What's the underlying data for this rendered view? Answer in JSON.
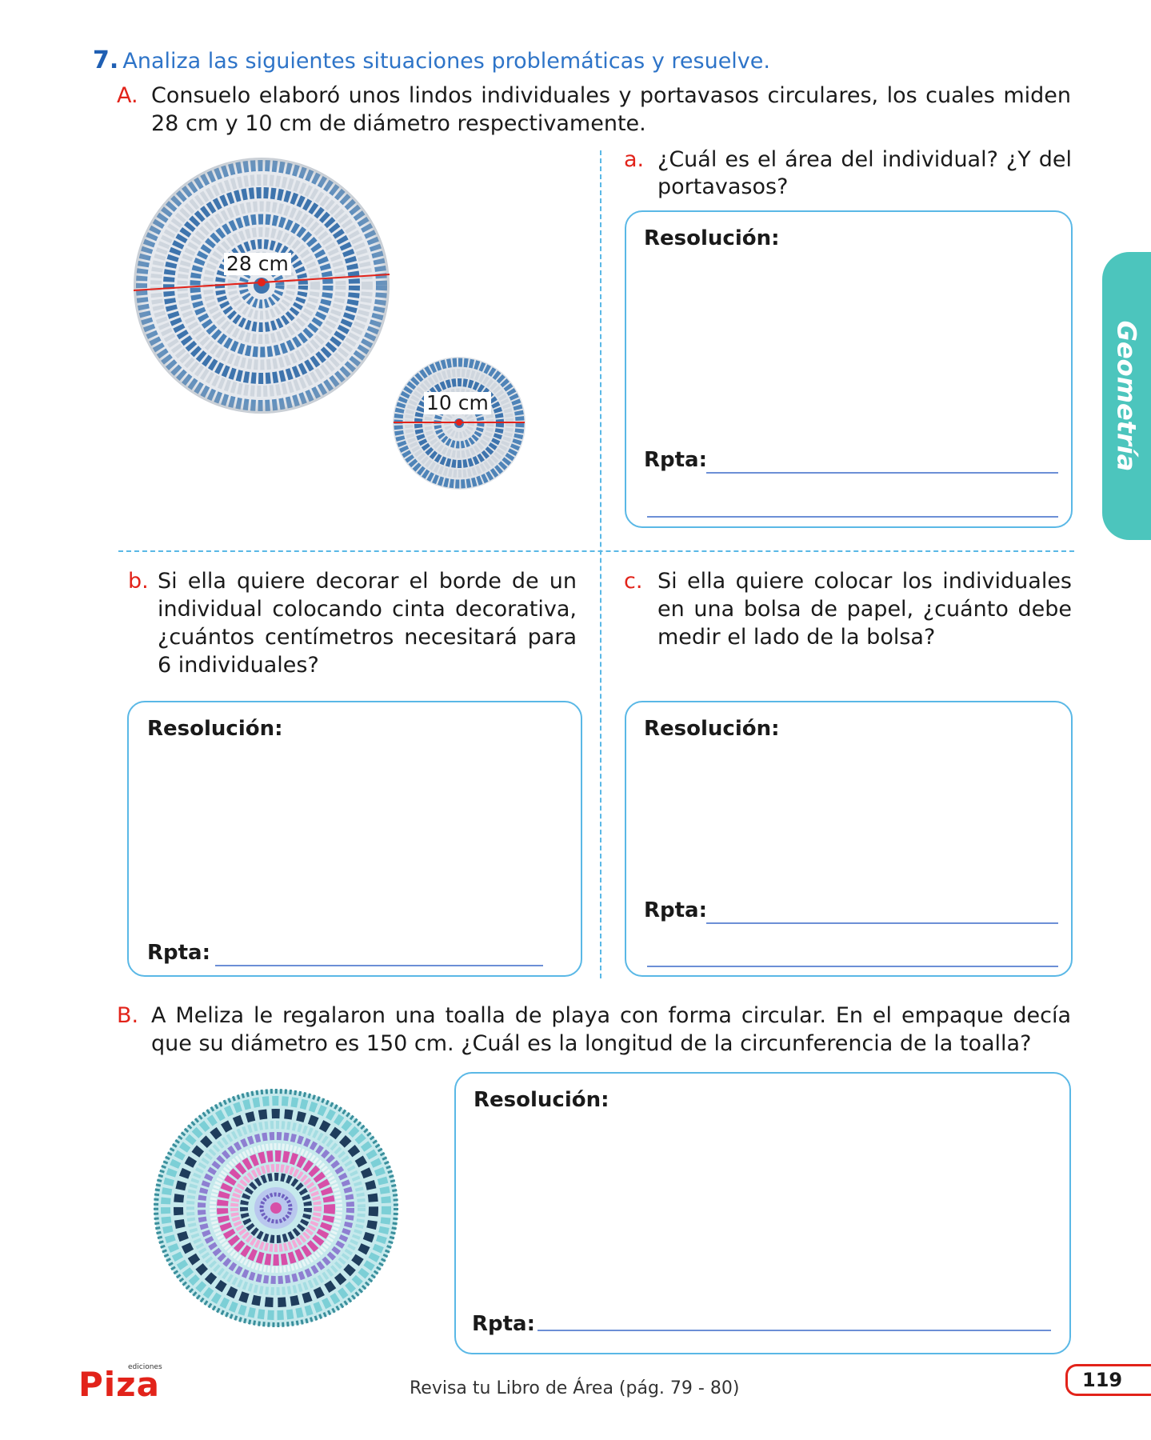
{
  "exercise": {
    "number": "7.",
    "instruction": "Analiza las siguientes situaciones problemáticas y resuelve."
  },
  "partA": {
    "marker": "A.",
    "text_line1": "Consuelo elaboró unos lindos individuales y portavasos circulares, los cuales miden",
    "text_line2": "28 cm y 10 cm de diámetro respectivamente.",
    "image_large_label": "28 cm",
    "image_small_label": "10 cm",
    "question_a": {
      "marker": "a.",
      "line1": "¿Cuál es el área del individual? ¿Y del",
      "line2": "portavasos?"
    },
    "question_b": {
      "marker": "b.",
      "line1": "Si ella quiere decorar el borde de un",
      "line2": "individual colocando cinta decorativa,",
      "line3": "¿cuántos centímetros necesitará para",
      "line4": "6 individuales?"
    },
    "question_c": {
      "marker": "c.",
      "line1": "Si ella quiere colocar los individuales",
      "line2": "en una bolsa de papel, ¿cuánto debe",
      "line3": "medir el lado de la bolsa?"
    }
  },
  "partB": {
    "marker": "B.",
    "text_line1": "A Meliza le regalaron una toalla de playa con forma circular. En el empaque decía",
    "text_line2": "que su diámetro es 150 cm. ¿Cuál es la longitud de la circunferencia de la toalla?"
  },
  "box_labels": {
    "resolution": "Resolución:",
    "answer": "Rpta:"
  },
  "side_tab": {
    "label": "Geometría",
    "color": "#4cc5bd"
  },
  "footer": {
    "logo": "Piza",
    "logo_small": "ediciones",
    "reference": "Revisa tu Libro de Área (pág. 79 - 80)",
    "page_number": "119"
  },
  "colors": {
    "accent_blue": "#2e74c8",
    "marker_red": "#e2231a",
    "box_border": "#5ab8e6",
    "answer_line": "#6c8fd6"
  }
}
